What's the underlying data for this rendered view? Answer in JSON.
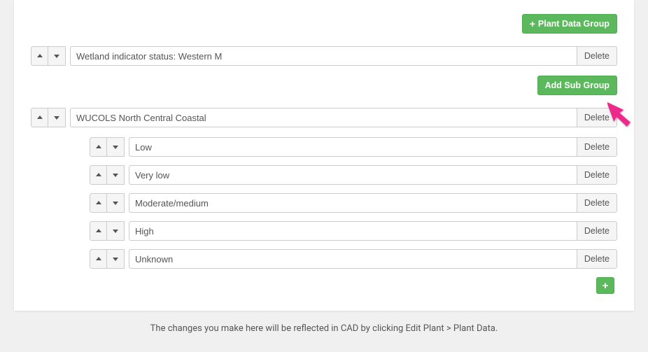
{
  "buttons": {
    "plant_data_group": "Plant Data Group",
    "add_sub_group": "Add Sub Group",
    "delete": "Delete"
  },
  "groups": [
    {
      "value": "Wetland indicator status: Western M"
    },
    {
      "value": "WUCOLS North Central Coastal",
      "subgroups": [
        {
          "value": "Low"
        },
        {
          "value": "Very low"
        },
        {
          "value": "Moderate/medium"
        },
        {
          "value": "High"
        },
        {
          "value": "Unknown"
        }
      ]
    }
  ],
  "footer": "The changes you make here will be reflected in CAD by clicking Edit Plant > Plant Data."
}
